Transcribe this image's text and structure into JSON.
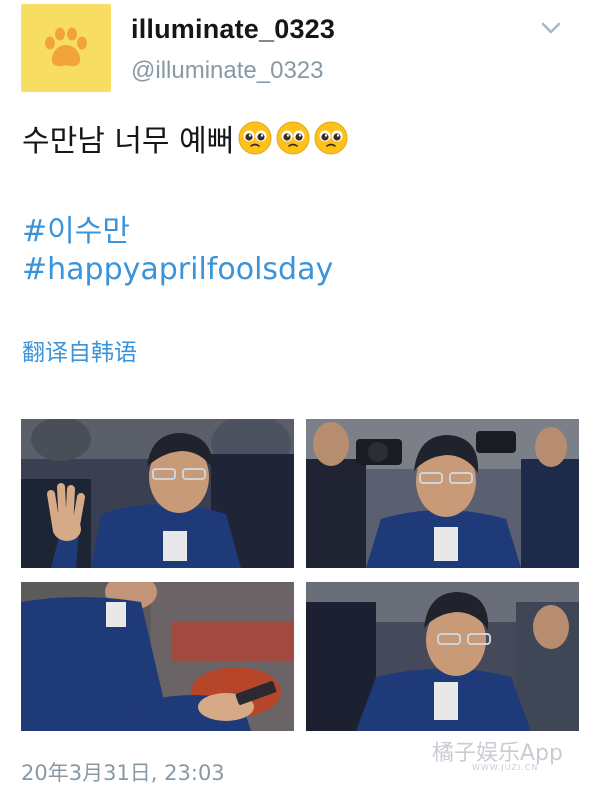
{
  "profile": {
    "display_name": "illuminate_0323",
    "handle": "@illuminate_0323",
    "avatar_color": "#f7de62",
    "avatar_icon": "paw-icon"
  },
  "tweet": {
    "text": "수만남 너무 예뻐",
    "emoji": [
      "pleading-face-emoji",
      "pleading-face-emoji",
      "pleading-face-emoji"
    ],
    "hashtags": [
      "#이수만",
      "#happyaprilfoolsday"
    ],
    "translate_label": "翻译自韩语",
    "timestamp": "20年3月31日, 23:03"
  },
  "media": {
    "photos": [
      {
        "name": "photo-waving"
      },
      {
        "name": "photo-crowd-cameras"
      },
      {
        "name": "photo-holding-phone"
      },
      {
        "name": "photo-smiling-down"
      }
    ]
  },
  "watermark": {
    "text": "橘子娱乐App",
    "sub": "WWW.JUZI.CN"
  },
  "colors": {
    "link": "#3b94d9",
    "secondary": "#8899a6",
    "primary_text": "#14171a",
    "background": "#ffffff"
  }
}
